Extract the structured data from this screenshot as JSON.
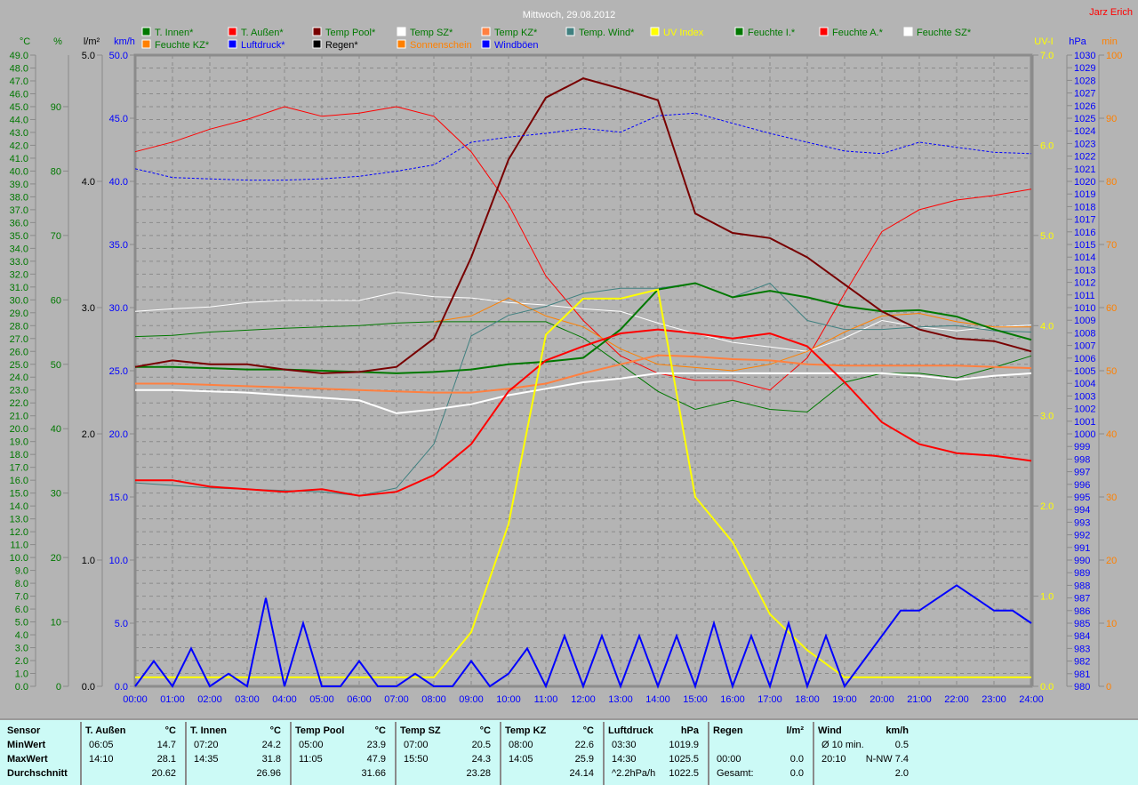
{
  "title": "Mittwoch, 29.08.2012",
  "author": "Jarz Erich",
  "legend": [
    {
      "label": "T. Innen*",
      "color": "#007800",
      "text": "#007800"
    },
    {
      "label": "T. Außen*",
      "color": "#ff0000",
      "text": "#007800"
    },
    {
      "label": "Temp Pool*",
      "color": "#780000",
      "text": "#007800"
    },
    {
      "label": "Temp SZ*",
      "color": "#ffffff",
      "text": "#007800"
    },
    {
      "label": "Temp KZ*",
      "color": "#ff8040",
      "text": "#007800"
    },
    {
      "label": "Temp. Wind*",
      "color": "#408080",
      "text": "#007800"
    },
    {
      "label": "UV Index",
      "color": "#ffff00",
      "text": "#ffff00"
    },
    {
      "label": "Feuchte I.*",
      "color": "#007800",
      "text": "#007800"
    },
    {
      "label": "Feuchte A.*",
      "color": "#ff0000",
      "text": "#007800"
    },
    {
      "label": "Feuchte SZ*",
      "color": "#ffffff",
      "text": "#007800"
    },
    {
      "label": "Feuchte KZ*",
      "color": "#ff8000",
      "text": "#007800"
    },
    {
      "label": "Luftdruck*",
      "color": "#0000ff",
      "text": "#0000ff"
    },
    {
      "label": "Regen*",
      "color": "#000000",
      "text": "#000000"
    },
    {
      "label": "Sonnenschein",
      "color": "#ff8000",
      "text": "#ff8000"
    },
    {
      "label": "Windböen",
      "color": "#0000ff",
      "text": "#0000ff"
    }
  ],
  "chart_data": {
    "type": "line",
    "title": "Mittwoch, 29.08.2012",
    "x_ticks": [
      "00:00",
      "01:00",
      "02:00",
      "03:00",
      "04:00",
      "05:00",
      "06:00",
      "07:00",
      "08:00",
      "09:00",
      "10:00",
      "11:00",
      "12:00",
      "13:00",
      "14:00",
      "15:00",
      "16:00",
      "17:00",
      "18:00",
      "19:00",
      "20:00",
      "21:00",
      "22:00",
      "23:00",
      "24:00"
    ],
    "axes": {
      "temp": {
        "unit": "°C",
        "min": 0,
        "max": 49,
        "step": 1,
        "decimals": 1,
        "color": "#007800"
      },
      "hum": {
        "unit": "%",
        "min": 0,
        "max": 98,
        "step": 10,
        "decimals": 0,
        "color": "#007800"
      },
      "rain": {
        "unit": "l/m²",
        "min": 0,
        "max": 5,
        "step": 1,
        "decimals": 1,
        "color": "#000000"
      },
      "wind": {
        "unit": "km/h",
        "min": 0,
        "max": 50,
        "step": 5,
        "decimals": 1,
        "color": "#0000ff"
      },
      "uv": {
        "unit": "UV-I",
        "min": 0,
        "max": 7,
        "step": 1,
        "decimals": 1,
        "color": "#ffff00"
      },
      "press": {
        "unit": "hPa",
        "min": 980,
        "max": 1030,
        "step": 1,
        "decimals": 0,
        "color": "#0000ff"
      },
      "sun": {
        "unit": "min",
        "min": 0,
        "max": 100,
        "step": 10,
        "decimals": 0,
        "color": "#ff8000"
      }
    },
    "series": [
      {
        "name": "Feuchte A.",
        "axis": "hum",
        "color": "#ff0000",
        "width": 1,
        "values": [
          83,
          84.5,
          86.5,
          88,
          90,
          88.5,
          89,
          90,
          88.5,
          83,
          74.8,
          63.7,
          56.8,
          51.3,
          48.6,
          47.5,
          47.5,
          46,
          51,
          61,
          70.6,
          74,
          75.5,
          76.2,
          77.2
        ]
      },
      {
        "name": "Feuchte I.",
        "axis": "hum",
        "color": "#007800",
        "width": 1,
        "values": [
          54.3,
          54.5,
          55,
          55.3,
          55.6,
          55.8,
          56,
          56.4,
          56.6,
          56.6,
          56.6,
          56.6,
          54.1,
          50,
          45.8,
          43,
          44.4,
          43,
          42.6,
          47.2,
          48.6,
          48.6,
          47.9,
          49.5,
          51.3
        ]
      },
      {
        "name": "Feuchte SZ",
        "axis": "hum",
        "color": "#ffffff",
        "width": 1,
        "values": [
          58.2,
          58.6,
          58.9,
          59.6,
          59.9,
          59.9,
          59.9,
          61.2,
          60.5,
          60.3,
          59.6,
          59.2,
          58.6,
          58.2,
          56.4,
          54.8,
          53.4,
          52.7,
          52,
          54.1,
          56.8,
          55.8,
          55.2,
          55.8,
          56.1
        ]
      },
      {
        "name": "Feuchte KZ",
        "axis": "hum",
        "color": "#ff8000",
        "width": 1,
        "values": [
          null,
          null,
          null,
          null,
          null,
          null,
          null,
          null,
          56.6,
          57.5,
          60.3,
          57.5,
          55.8,
          52.4,
          50,
          49.5,
          49,
          50,
          52,
          55,
          57.5,
          57.9,
          56.6,
          55.8,
          55.8
        ]
      },
      {
        "name": "Temp. Wind",
        "axis": "temp",
        "color": "#408080",
        "width": 1,
        "values": [
          15.8,
          15.6,
          15.4,
          15.3,
          15.2,
          15.1,
          14.8,
          15.4,
          18.8,
          27.2,
          28.8,
          29.5,
          30.5,
          30.9,
          30.9,
          31.3,
          30.2,
          31.3,
          28.4,
          27.7,
          27.7,
          27.9,
          28,
          27.6,
          27.5
        ]
      },
      {
        "name": "Temp KZ",
        "axis": "temp",
        "color": "#ff8040",
        "width": 2,
        "values": [
          23.5,
          23.5,
          23.4,
          23.3,
          23.2,
          23.1,
          23.0,
          22.9,
          22.8,
          22.8,
          23.1,
          23.5,
          24.3,
          25.0,
          25.7,
          25.6,
          25.4,
          25.3,
          25.0,
          24.9,
          24.9,
          24.9,
          24.9,
          24.8,
          24.7
        ]
      },
      {
        "name": "Temp SZ",
        "axis": "temp",
        "color": "#ffffff",
        "width": 2,
        "values": [
          23.0,
          23.0,
          22.9,
          22.8,
          22.6,
          22.4,
          22.2,
          21.2,
          21.5,
          21.9,
          22.6,
          23.1,
          23.6,
          23.9,
          24.3,
          24.3,
          24.3,
          24.3,
          24.3,
          24.3,
          24.3,
          24.1,
          23.8,
          24.1,
          24.3
        ]
      },
      {
        "name": "T. Innen",
        "axis": "temp",
        "color": "#007800",
        "width": 2,
        "values": [
          24.8,
          24.8,
          24.7,
          24.6,
          24.6,
          24.5,
          24.4,
          24.3,
          24.4,
          24.6,
          25.0,
          25.2,
          25.5,
          27.7,
          30.8,
          31.3,
          30.2,
          30.7,
          30.2,
          29.5,
          29.1,
          29.2,
          28.7,
          27.7,
          26.9
        ]
      },
      {
        "name": "T. Außen",
        "axis": "temp",
        "color": "#ff0000",
        "width": 2,
        "values": [
          16.0,
          16.0,
          15.5,
          15.3,
          15.1,
          15.3,
          14.8,
          15.1,
          16.4,
          18.8,
          22.9,
          25.3,
          26.4,
          27.4,
          27.7,
          27.4,
          27.0,
          27.4,
          26.4,
          23.6,
          20.5,
          18.8,
          18.1,
          17.9,
          17.5
        ]
      },
      {
        "name": "Temp Pool",
        "axis": "temp",
        "color": "#780000",
        "width": 2,
        "values": [
          24.8,
          25.3,
          25.0,
          25.0,
          24.6,
          24.3,
          24.4,
          24.8,
          27.0,
          33.3,
          40.9,
          45.7,
          47.2,
          46.4,
          45.5,
          36.7,
          35.2,
          34.8,
          33.3,
          31.2,
          29.1,
          27.7,
          27.0,
          26.8,
          26.0
        ]
      },
      {
        "name": "Luftdruck",
        "axis": "press",
        "color": "#0000ff",
        "width": 1,
        "dash": "3,2",
        "values": [
          1021,
          1020.3,
          1020.2,
          1020.1,
          1020.1,
          1020.2,
          1020.4,
          1020.8,
          1021.3,
          1023.1,
          1023.5,
          1023.8,
          1024.2,
          1023.9,
          1025.2,
          1025.4,
          1024.6,
          1023.8,
          1023.1,
          1022.4,
          1022.2,
          1023.1,
          1022.7,
          1022.3,
          1022.2
        ]
      },
      {
        "name": "UV Index",
        "axis": "uv",
        "color": "#ffff00",
        "width": 2,
        "values": [
          0.1,
          0.1,
          0.1,
          0.1,
          0.1,
          0.1,
          0.1,
          0.1,
          0.1,
          0.6,
          1.8,
          3.9,
          4.3,
          4.3,
          4.4,
          2.1,
          1.6,
          0.8,
          0.4,
          0.1,
          0.1,
          0.1,
          0.1,
          0.1,
          0.1
        ]
      },
      {
        "name": "Windböen",
        "axis": "wind",
        "color": "#0000ff",
        "width": 2,
        "step": 0.5,
        "values": [
          0,
          2,
          0,
          3,
          0,
          1,
          0,
          7,
          0,
          5,
          0,
          0,
          2,
          0,
          0,
          1,
          0,
          0,
          2,
          0,
          1,
          3,
          0,
          4,
          0,
          4,
          0,
          4,
          0,
          4,
          0,
          5,
          0,
          4,
          0,
          5,
          0,
          4,
          0,
          2,
          4,
          6,
          6,
          7,
          8,
          7,
          6,
          6,
          5
        ]
      }
    ]
  },
  "stats": {
    "sensor": {
      "head": "Sensor",
      "rows": [
        "MinWert",
        "MaxWert",
        "Durchschnitt"
      ]
    },
    "cols": [
      {
        "name": "T. Außen",
        "unit": "°C",
        "rows": [
          [
            "06:05",
            "14.7"
          ],
          [
            "14:10",
            "28.1"
          ],
          [
            "",
            "20.62"
          ]
        ]
      },
      {
        "name": "T. Innen",
        "unit": "°C",
        "rows": [
          [
            "07:20",
            "24.2"
          ],
          [
            "14:35",
            "31.8"
          ],
          [
            "",
            "26.96"
          ]
        ]
      },
      {
        "name": "Temp Pool",
        "unit": "°C",
        "rows": [
          [
            "05:00",
            "23.9"
          ],
          [
            "11:05",
            "47.9"
          ],
          [
            "",
            "31.66"
          ]
        ]
      },
      {
        "name": "Temp SZ",
        "unit": "°C",
        "rows": [
          [
            "07:00",
            "20.5"
          ],
          [
            "15:50",
            "24.3"
          ],
          [
            "",
            "23.28"
          ]
        ]
      },
      {
        "name": "Temp KZ",
        "unit": "°C",
        "rows": [
          [
            "08:00",
            "22.6"
          ],
          [
            "14:05",
            "25.9"
          ],
          [
            "",
            "24.14"
          ]
        ]
      },
      {
        "name": "Luftdruck",
        "unit": "hPa",
        "rows": [
          [
            "03:30",
            "1019.9"
          ],
          [
            "14:30",
            "1025.5"
          ],
          [
            "^2.2hPa/h",
            "1022.5"
          ]
        ]
      },
      {
        "name": "Regen",
        "unit": "l/m²",
        "rows": [
          [
            "",
            ""
          ],
          [
            "00:00",
            "0.0"
          ],
          [
            "Gesamt:",
            "0.0"
          ]
        ]
      },
      {
        "name": "Wind",
        "unit": "km/h",
        "rows": [
          [
            "Ø 10 min.",
            "0.5"
          ],
          [
            "20:10",
            "N-NW 7.4"
          ],
          [
            "",
            "2.0"
          ]
        ]
      }
    ]
  }
}
